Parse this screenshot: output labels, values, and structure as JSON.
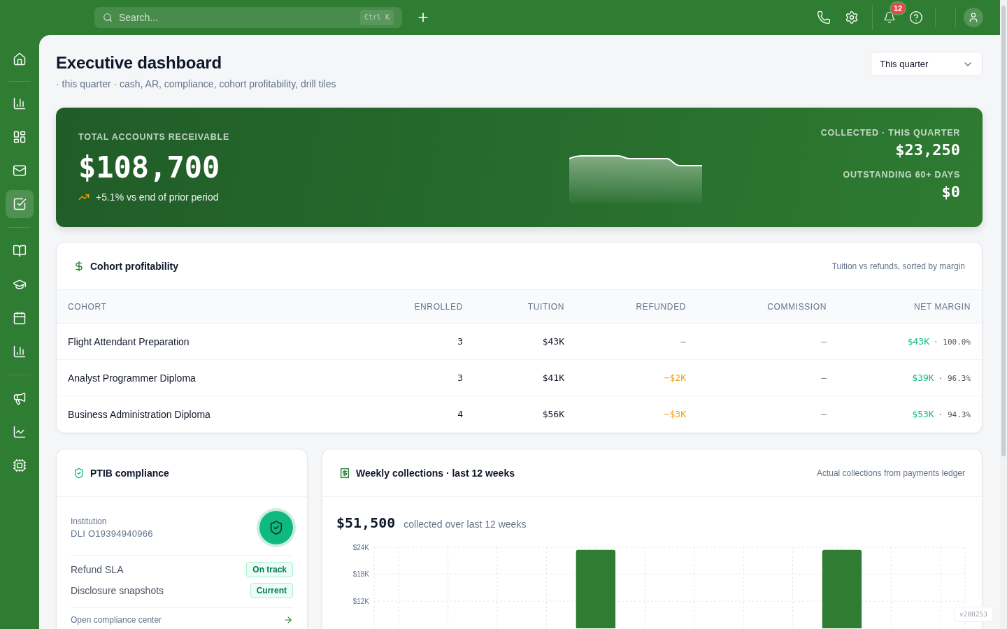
{
  "topbar": {
    "search": {
      "placeholder": "Search...",
      "shortcut": "Ctrl K"
    },
    "notifications": {
      "count": "12"
    }
  },
  "sidebar": {
    "groups": [
      {
        "items": [
          {
            "selected": false
          }
        ]
      },
      {
        "items": [
          {
            "selected": false
          },
          {
            "selected": false
          },
          {
            "selected": false
          },
          {
            "selected": true
          }
        ]
      },
      {
        "items": [
          {
            "selected": false
          },
          {
            "selected": false
          },
          {
            "selected": false
          },
          {
            "selected": false
          }
        ]
      },
      {
        "items": [
          {
            "selected": false
          },
          {
            "selected": false
          },
          {
            "selected": false
          }
        ]
      }
    ]
  },
  "page": {
    "title": "Executive dashboard",
    "subtitle": "· this quarter · cash, AR, compliance, cohort profitability, drill tiles",
    "period_select": {
      "value": "This quarter"
    }
  },
  "summary": {
    "label": "TOTAL ACCOUNTS RECEIVABLE",
    "value": "$108,700",
    "trend": "+5.1% vs end of prior period",
    "stats": [
      {
        "label": "COLLECTED · THIS QUARTER",
        "value": "$23,250"
      },
      {
        "label": "OUTSTANDING 60+ DAYS",
        "value": "$0"
      }
    ]
  },
  "cohort_table": {
    "title": "Cohort profitability",
    "note": "Tuition vs refunds, sorted by margin",
    "columns": [
      "COHORT",
      "ENROLLED",
      "TUITION",
      "REFUNDED",
      "COMMISSION",
      "NET MARGIN"
    ],
    "rows": [
      {
        "cohort": "Flight Attendant Preparation",
        "enrolled": "3",
        "tuition": "$43K",
        "refunded": {
          "text": "—",
          "kind": "empty"
        },
        "commission": {
          "text": "—",
          "kind": "empty"
        },
        "net_margin": "$43K",
        "margin_pct": "· 100.0%"
      },
      {
        "cohort": "Analyst Programmer Diploma",
        "enrolled": "3",
        "tuition": "$41K",
        "refunded": {
          "text": "−$2K",
          "kind": "negative"
        },
        "commission": {
          "text": "—",
          "kind": "empty"
        },
        "net_margin": "$39K",
        "margin_pct": "· 96.3%"
      },
      {
        "cohort": "Business Administration Diploma",
        "enrolled": "4",
        "tuition": "$56K",
        "refunded": {
          "text": "−$3K",
          "kind": "negative"
        },
        "commission": {
          "text": "—",
          "kind": "empty"
        },
        "net_margin": "$53K",
        "margin_pct": "· 94.3%"
      }
    ]
  },
  "compliance": {
    "title": "PTIB compliance",
    "institution": {
      "label": "Institution",
      "value": "DLI O19394940966"
    },
    "checks": [
      {
        "label": "Refund SLA",
        "status": "On track"
      },
      {
        "label": "Disclosure snapshots",
        "status": "Current"
      }
    ],
    "link": "Open compliance center"
  },
  "collections": {
    "title": "Weekly collections · last 12 weeks",
    "note": "Actual collections from payments ledger",
    "total": "$51,500",
    "total_caption": "collected over last 12 weeks",
    "chart_data": {
      "type": "bar",
      "values": [
        null,
        null,
        null,
        null,
        23400,
        null,
        null,
        null,
        null,
        23400,
        null,
        null
      ],
      "ylim": [
        6000,
        24000
      ],
      "yticks": [
        {
          "value": 24000,
          "label": "$24K"
        },
        {
          "value": 18000,
          "label": "$18K"
        },
        {
          "value": 12000,
          "label": "$12K"
        }
      ],
      "grid": true
    }
  },
  "version_tag": "v200253"
}
